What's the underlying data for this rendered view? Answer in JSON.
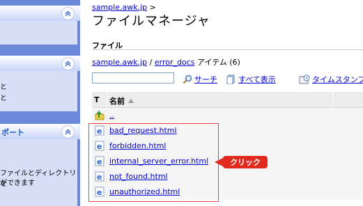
{
  "sidebar": {
    "panels": [
      {
        "title": "",
        "lines": []
      },
      {
        "title": "",
        "lines": [
          "と",
          "と"
        ]
      },
      {
        "title": "ポート",
        "lines": [
          "ファイルとディレクトリを",
          "ができます"
        ]
      }
    ]
  },
  "header": {
    "breadcrumb_link": "sample.awk.jp",
    "breadcrumb_sep": " >",
    "title": "ファイルマネージャ"
  },
  "section": {
    "label": "ファイル"
  },
  "path": {
    "root": "sample.awk.jp",
    "sep": " / ",
    "dir": "error_docs",
    "suffix": " アイテム (6)"
  },
  "toolbar": {
    "filter_value": "",
    "search_label": "サーチ",
    "show_all_label": "すべて表示",
    "timestamp_label": "タイムスタンプ"
  },
  "table": {
    "col_type": "T",
    "col_name": "名前",
    "rows": [
      {
        "name": "..",
        "icon": "folder-up-icon"
      },
      {
        "name": "bad_request.html",
        "icon": "ie-file-icon"
      },
      {
        "name": "forbidden.html",
        "icon": "ie-file-icon"
      },
      {
        "name": "internal_server_error.html",
        "icon": "ie-file-icon"
      },
      {
        "name": "not_found.html",
        "icon": "ie-file-icon"
      },
      {
        "name": "unauthorized.html",
        "icon": "ie-file-icon"
      }
    ]
  },
  "callout": {
    "label": "クリック"
  },
  "colors": {
    "sidebar": "#6b87d8",
    "link": "#0000cc",
    "highlight": "#e8413f",
    "callout": "#e02a1d"
  }
}
